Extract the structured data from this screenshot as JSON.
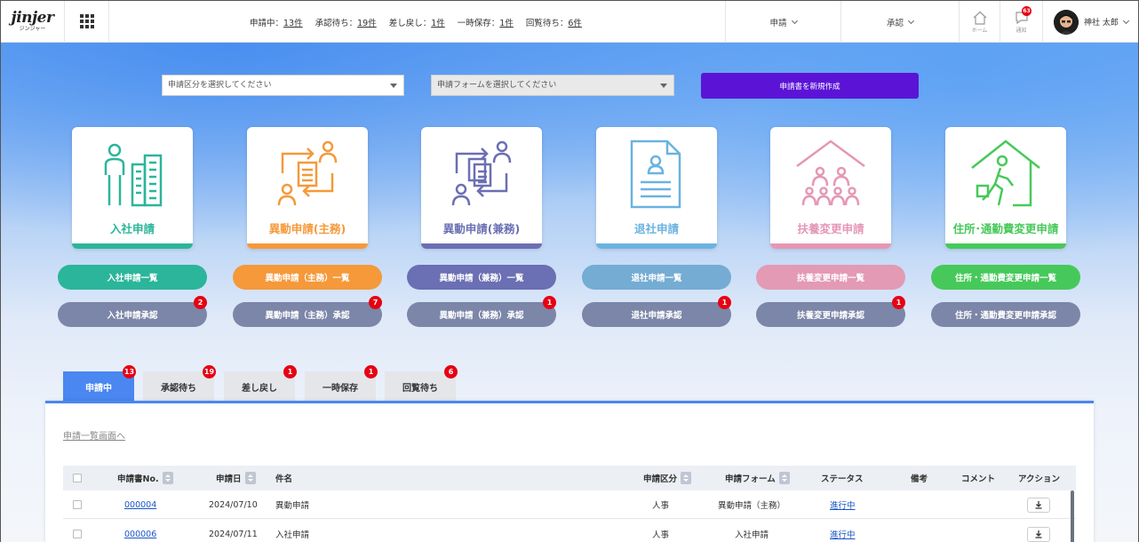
{
  "header": {
    "logo": "jinjer",
    "logo_sub": "ジンジャー",
    "status": [
      {
        "label": "申請中：",
        "count": "13件"
      },
      {
        "label": "承認待ち：",
        "count": "19件"
      },
      {
        "label": "差し戻し：",
        "count": "1件"
      },
      {
        "label": "一時保存：",
        "count": "1件"
      },
      {
        "label": "回覧待ち：",
        "count": "6件"
      }
    ],
    "menu_apply": "申請",
    "menu_approve": "承認",
    "home_label": "ホーム",
    "notify_label": "通知",
    "notify_count": "63",
    "user_name": "神社 太郎"
  },
  "filters": {
    "category_placeholder": "申請区分を選択してください",
    "form_placeholder": "申請フォームを選択してください",
    "create_button": "申請書を新規作成"
  },
  "cards": [
    {
      "label": "入社申請",
      "color": "#2bb59a",
      "list": "入社申請一覧",
      "approve": "入社申請承認",
      "badge": "2"
    },
    {
      "label": "異動申請(主務)",
      "color": "#f5993a",
      "list": "異動申請（主務）一覧",
      "approve": "異動申請（主務）承認",
      "badge": "7"
    },
    {
      "label": "異動申請(兼務)",
      "color": "#6b6fb3",
      "list": "異動申請（兼務）一覧",
      "approve": "異動申請（兼務）承認",
      "badge": "1"
    },
    {
      "label": "退社申請",
      "color": "#6ab3df",
      "list": "退社申請一覧",
      "approve": "退社申請承認",
      "badge": "1"
    },
    {
      "label": "扶養変更申請",
      "color": "#e597b5",
      "list": "扶養変更申請一覧",
      "approve": "扶養変更申請承認",
      "badge": "1"
    },
    {
      "label": "住所･通勤費変更申請",
      "color": "#46c95a",
      "list": "住所・通勤費変更申請一覧",
      "approve": "住所・通勤費変更申請承認",
      "badge": ""
    }
  ],
  "tabs": [
    {
      "label": "申請中",
      "badge": "13"
    },
    {
      "label": "承認待ち",
      "badge": "19"
    },
    {
      "label": "差し戻し",
      "badge": "1"
    },
    {
      "label": "一時保存",
      "badge": "1"
    },
    {
      "label": "回覧待ち",
      "badge": "6"
    }
  ],
  "panel": {
    "list_link": "申請一覧画面へ",
    "columns": {
      "no": "申請書No.",
      "date": "申請日",
      "subject": "件名",
      "category": "申請区分",
      "form": "申請フォーム",
      "status": "ステータス",
      "note": "備考",
      "comment": "コメント",
      "action": "アクション"
    },
    "rows": [
      {
        "no": "000004",
        "date": "2024/07/10",
        "subject": "異動申請",
        "category": "人事",
        "form": "異動申請（主務）",
        "status": "進行中"
      },
      {
        "no": "000006",
        "date": "2024/07/11",
        "subject": "入社申請",
        "category": "人事",
        "form": "入社申請",
        "status": "進行中"
      }
    ]
  }
}
